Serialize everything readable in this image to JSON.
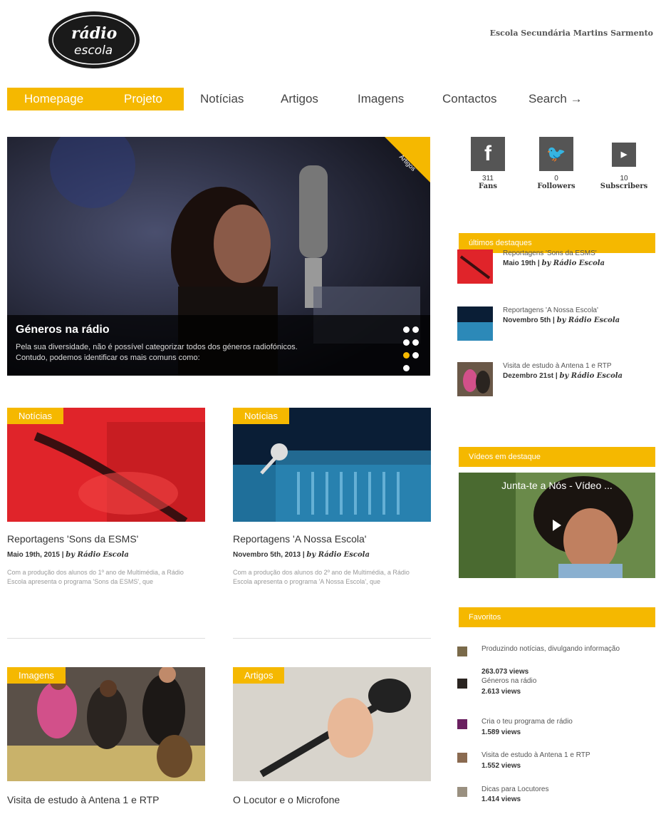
{
  "header": {
    "logo_text_1": "rádio",
    "logo_text_2": "escola",
    "school_name": "Escola Secundária Martins Sarmento"
  },
  "nav": {
    "items": [
      {
        "label": "Homepage"
      },
      {
        "label": "Projeto"
      },
      {
        "label": "Notícias"
      },
      {
        "label": "Artigos"
      },
      {
        "label": "Imagens"
      },
      {
        "label": "Contactos"
      },
      {
        "label": "Search →"
      }
    ]
  },
  "hero": {
    "ribbon": "Artigos",
    "title": "Géneros na rádio",
    "description": "Pela sua diversidade, não é possível categorizar todos dos géneros radiofónicos. Contudo, podemos identificar os mais comuns como:"
  },
  "cards": [
    {
      "tag": "Notícias",
      "title": "Reportagens 'Sons da ESMS'",
      "date": "Maio 19th, 2015 |",
      "by": "by Rádio Escola",
      "excerpt": "Com a produção dos alunos do 1º ano de Multimédia, a Rádio Escola apresenta o programa 'Sons da ESMS', que"
    },
    {
      "tag": "Notícias",
      "title": "Reportagens 'A Nossa Escola'",
      "date": "Novembro 5th, 2013 |",
      "by": "by Rádio Escola",
      "excerpt": "Com a produção dos alunos do 2º ano de Multimédia, a Rádio Escola apresenta o programa 'A Nossa Escola', que"
    },
    {
      "tag": "Imagens",
      "title": "Visita de estudo à Antena 1 e RTP"
    },
    {
      "tag": "Artigos",
      "title": "O Locutor e o Microfone"
    }
  ],
  "social": [
    {
      "icon": "facebook-icon",
      "count": "311",
      "label": "Fans"
    },
    {
      "icon": "twitter-icon",
      "count": "0",
      "label": "Followers"
    },
    {
      "icon": "youtube-icon",
      "count": "10",
      "label": "Subscribers"
    }
  ],
  "ultimos": {
    "heading": "últimos destaques",
    "items": [
      {
        "title": "Reportagens 'Sons da ESMS'",
        "date": "Maio 19th |",
        "by": "by Rádio Escola"
      },
      {
        "title": "Reportagens 'A Nossa Escola'",
        "date": "Novembro 5th |",
        "by": "by Rádio Escola"
      },
      {
        "title": "Visita de estudo à Antena 1 e RTP",
        "date": "Dezembro 21st |",
        "by": "by Rádio Escola"
      }
    ]
  },
  "videos": {
    "heading": "Vídeos em destaque",
    "video_title": "Junta-te a Nós - Vídeo ..."
  },
  "favoritos": {
    "heading": "Favoritos",
    "items": [
      {
        "title": "Produzindo notícias, divulgando informação",
        "views": "263.073 views"
      },
      {
        "title": "Géneros na rádio",
        "views": "2.613 views"
      },
      {
        "title": "Cria o teu programa de rádio",
        "views": "1.589 views"
      },
      {
        "title": "Visita de estudo à Antena 1 e RTP",
        "views": "1.552 views"
      },
      {
        "title": "Dicas para Locutores",
        "views": "1.414 views"
      }
    ]
  },
  "colors": {
    "accent": "#f5b800"
  }
}
